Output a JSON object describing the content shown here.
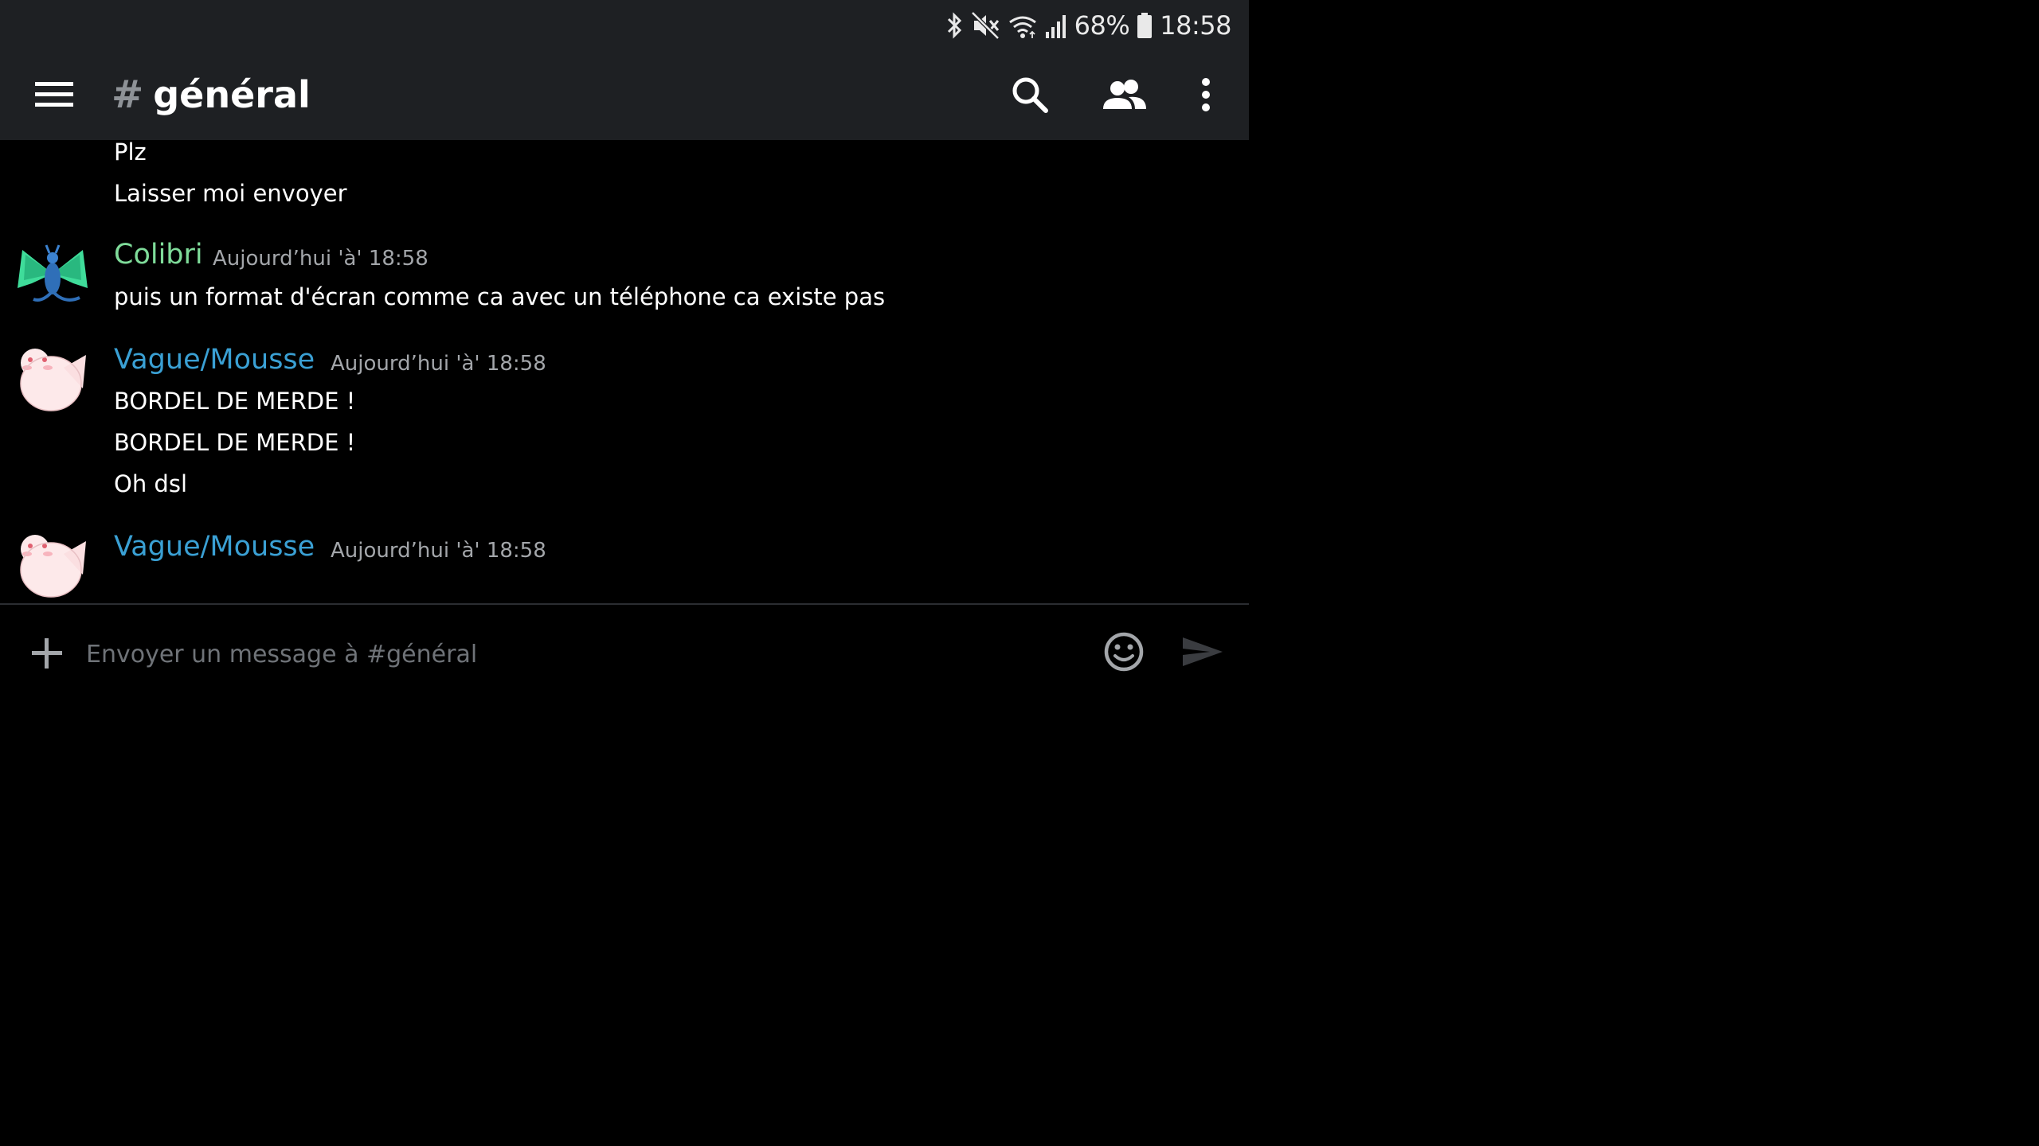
{
  "statusbar": {
    "battery_percent": "68%",
    "time": "18:58"
  },
  "header": {
    "hash": "#",
    "channel": "général"
  },
  "messages": {
    "continued": [
      "Plz",
      "Laisser moi envoyer"
    ],
    "groups": [
      {
        "author": "Colibri",
        "author_color": "#7fdc9a",
        "timestamp": "Aujourd’hui 'à' 18:58",
        "lines": [
          "puis un format d'écran comme ca avec un téléphone ca existe pas"
        ]
      },
      {
        "author": "Vague/Mousse",
        "author_color": "#3aa0d4",
        "timestamp": "Aujourd’hui 'à' 18:58",
        "lines": [
          "BORDEL DE MERDE !",
          "BORDEL DE MERDE !",
          "Oh dsl"
        ]
      },
      {
        "author": "Vague/Mousse",
        "author_color": "#3aa0d4",
        "timestamp": "Aujourd’hui 'à' 18:58",
        "lines": []
      }
    ]
  },
  "composer": {
    "placeholder": "Envoyer un message à #général"
  },
  "icons": {
    "status": [
      "bluetooth-icon",
      "mute-icon",
      "wifi-icon",
      "signal-icon",
      "battery-icon"
    ],
    "appbar": [
      "menu-icon",
      "search-icon",
      "members-icon",
      "more-icon"
    ],
    "composer": [
      "plus-icon",
      "emoji-icon",
      "send-icon"
    ]
  }
}
